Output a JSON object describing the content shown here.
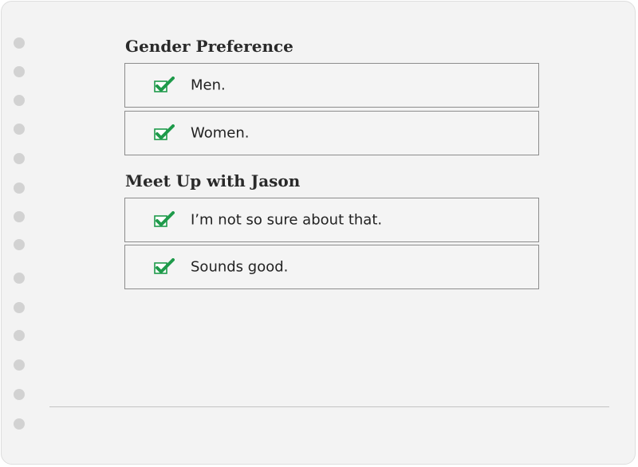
{
  "sections": [
    {
      "title": "Gender Preference",
      "options": [
        {
          "label": "Men.",
          "checked": true
        },
        {
          "label": "Women.",
          "checked": true
        }
      ]
    },
    {
      "title": "Meet Up with Jason",
      "options": [
        {
          "label": "I’m not so sure about that.",
          "checked": true
        },
        {
          "label": "Sounds good.",
          "checked": true
        }
      ]
    }
  ],
  "colors": {
    "check": "#1e9a4a",
    "border": "#8c8c8c"
  }
}
